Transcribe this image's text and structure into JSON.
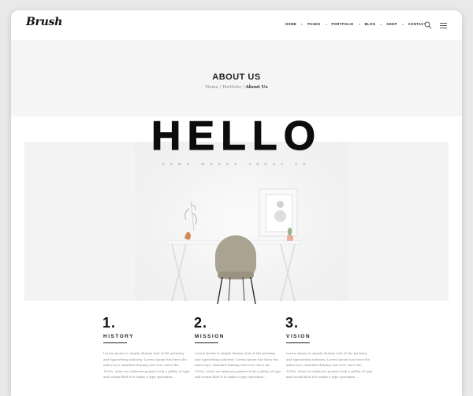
{
  "nav": {
    "logo": "Brush",
    "items": [
      "HOME",
      "PAGES",
      "PORTFOLIO",
      "BLOG",
      "SHOP",
      "CONTACT"
    ]
  },
  "header": {
    "title": "ABOUT US",
    "breadcrumb": [
      "Home",
      "Portfolio",
      "About Us"
    ]
  },
  "hero": {
    "heading": "HELLO",
    "tagline": "SOME WORDS ABOUT US"
  },
  "sections": [
    {
      "number": "1.",
      "title": "HISTORY",
      "text": "Lorem Ipsum is simply dummy text of the printing and typesetting industry. Lorem Ipsum has been the indus-try's standard dummy text ever since the 1500s, when an unknown printer took a galley of type and scram-bled it to make a type specimen..."
    },
    {
      "number": "2.",
      "title": "MISSION",
      "text": "Lorem Ipsum is simply dummy text of the printing and typesetting industry. Lorem Ipsum has been the indus-try's standard dummy text ever since the 1500s, when an unknown printer took a galley of type and scram-bled it to make a type specimen..."
    },
    {
      "number": "3.",
      "title": "VISION",
      "text": "Lorem Ipsum is simply dummy text of the printing and typesetting industry. Lorem Ipsum has been the indus-try's standard dummy text ever since the 1500s, when an unknown printer took a galley of type and scram-bled it to make a type specimen..."
    }
  ],
  "colors": {
    "text": "#222222",
    "band": "#f5f5f5",
    "chair": "#aaa392"
  }
}
